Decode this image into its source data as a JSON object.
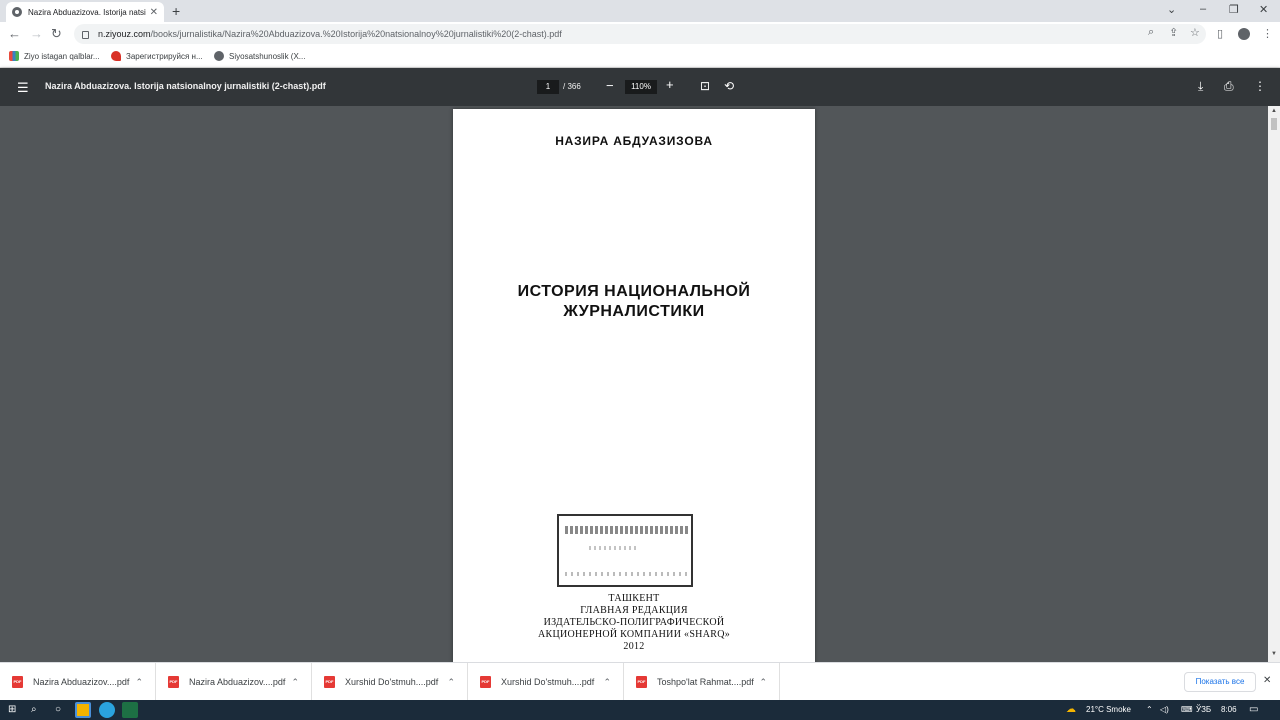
{
  "browser": {
    "tab_title": "Nazira Abduazizova. Istorija natsi",
    "tab_close": "✕",
    "new_tab": "+",
    "url_host": "n.ziyouz.com",
    "url_path": "/books/jurnalistika/Nazira%20Abduazizova.%20Istorija%20natsionalnoy%20jurnalistiki%20(2-chast).pdf",
    "bookmarks": [
      {
        "label": "Ziyo istagan qalblar...",
        "icon_color": "#e84b3c"
      },
      {
        "label": "Зарегистрируйся н...",
        "icon_color": "#d93025"
      },
      {
        "label": "Siyosatshunoslik (X...",
        "icon_color": "#5f6368"
      }
    ]
  },
  "pdf_toolbar": {
    "title": "Nazira Abduazizova. Istorija natsionalnoy jurnalistiki (2-chast).pdf",
    "page_current": "1",
    "page_total": "/ 366",
    "zoom": "110%"
  },
  "document": {
    "author": "НАЗИРА АБДУАЗИЗОВА",
    "title_line1": "ИСТОРИЯ НАЦИОНАЛЬНОЙ",
    "title_line2": "ЖУРНАЛИСТИКИ",
    "publisher": [
      "ТАШКЕНТ",
      "ГЛАВНАЯ РЕДАКЦИЯ",
      "ИЗДАТЕЛЬСКО-ПОЛИГРАФИЧЕСКОЙ",
      "АКЦИОНЕРНОЙ КОМПАНИИ «SHARQ»",
      "2012"
    ]
  },
  "downloads": {
    "items": [
      "Nazira Abduazizov....pdf",
      "Nazira Abduazizov....pdf",
      "Xurshid Do'stmuh....pdf",
      "Xurshid Do'stmuh....pdf",
      "Toshpo'lat Rahmat....pdf"
    ],
    "show_all": "Показать все"
  },
  "taskbar": {
    "weather": "21°C  Smoke",
    "language": "ЎЗБ",
    "time": "8:06"
  }
}
